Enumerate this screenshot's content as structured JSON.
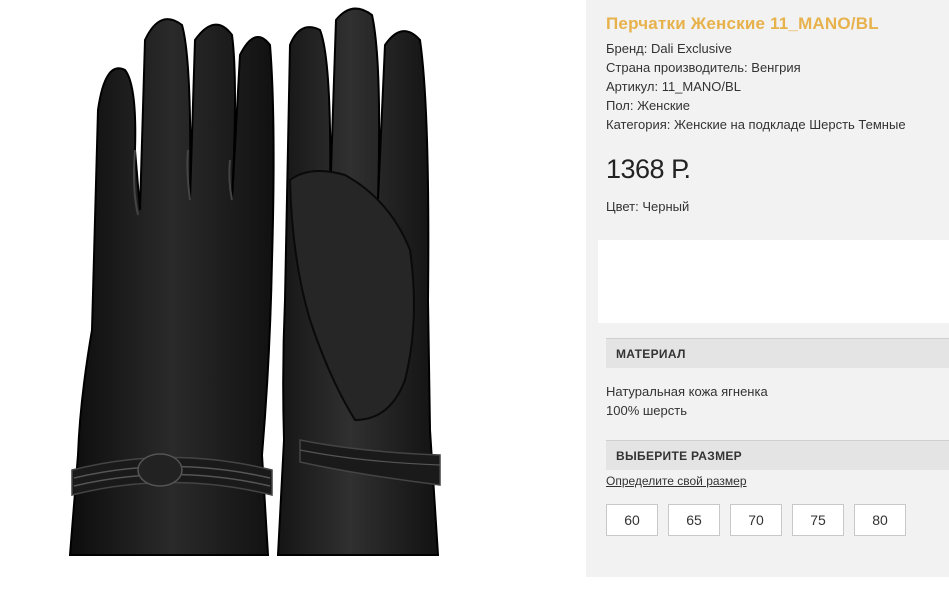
{
  "product": {
    "title": "Перчатки Женские 11_MANO/BL",
    "specs": [
      "Бренд: Dali Exclusive",
      "Страна производитель: Венгрия",
      "Артикул: 11_MANO/BL",
      "Пол: Женские",
      "Категория: Женские на подкладе Шерсть Темные"
    ],
    "price": "1368 Р.",
    "color": "Цвет: Черный"
  },
  "material": {
    "header": "МАТЕРИАЛ",
    "lines": [
      "Натуральная кожа ягненка",
      "100% шерсть"
    ]
  },
  "size": {
    "header": "ВЫБЕРИТЕ РАЗМЕР",
    "link": "Определите свой размер",
    "options": [
      "60",
      "65",
      "70",
      "75",
      "80"
    ]
  },
  "colors": {
    "title": "#e7b24c",
    "panel": "#f2f2f2",
    "section_header": "#e4e4e4"
  }
}
